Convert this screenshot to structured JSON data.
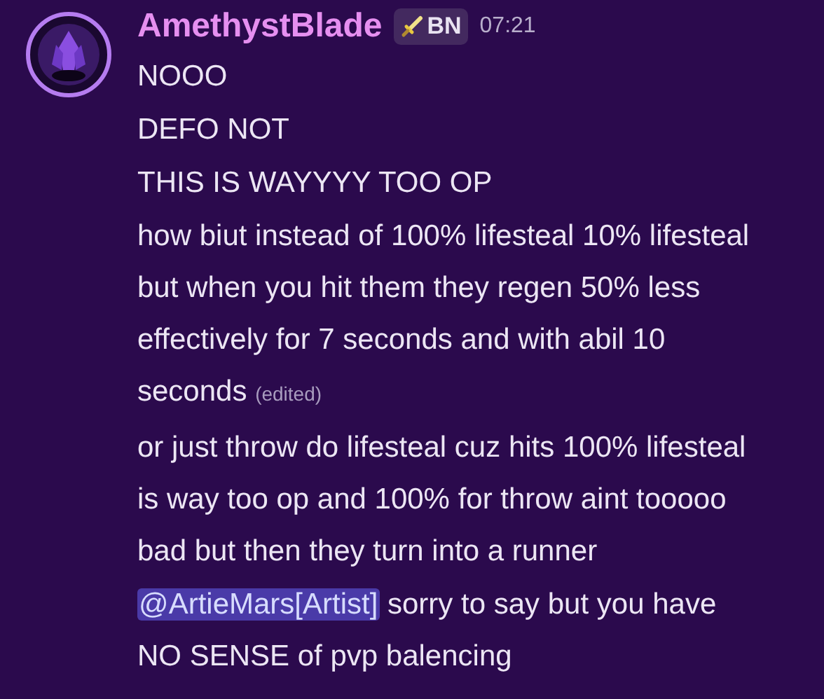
{
  "author": {
    "name": "AmethystBlade",
    "tag": "BN",
    "time": "07:21"
  },
  "messages": [
    {
      "text": "NOOO"
    },
    {
      "text": "DEFO NOT"
    },
    {
      "text": "THIS IS WAYYYY TOO OP"
    },
    {
      "text": "how biut instead of 100% lifesteal 10% lifesteal but when you hit them they regen 50% less effectively for 7 seconds and with abil 10 seconds",
      "edited": "(edited)"
    },
    {
      "text": "or just throw do lifesteal cuz hits 100% lifesteal is way too op and 100% for throw aint tooooo bad but then they turn into a runner"
    },
    {
      "mention": "@ArtieMars[Artist]",
      "text": " sorry to say but you have NO SENSE of pvp balencing"
    }
  ]
}
